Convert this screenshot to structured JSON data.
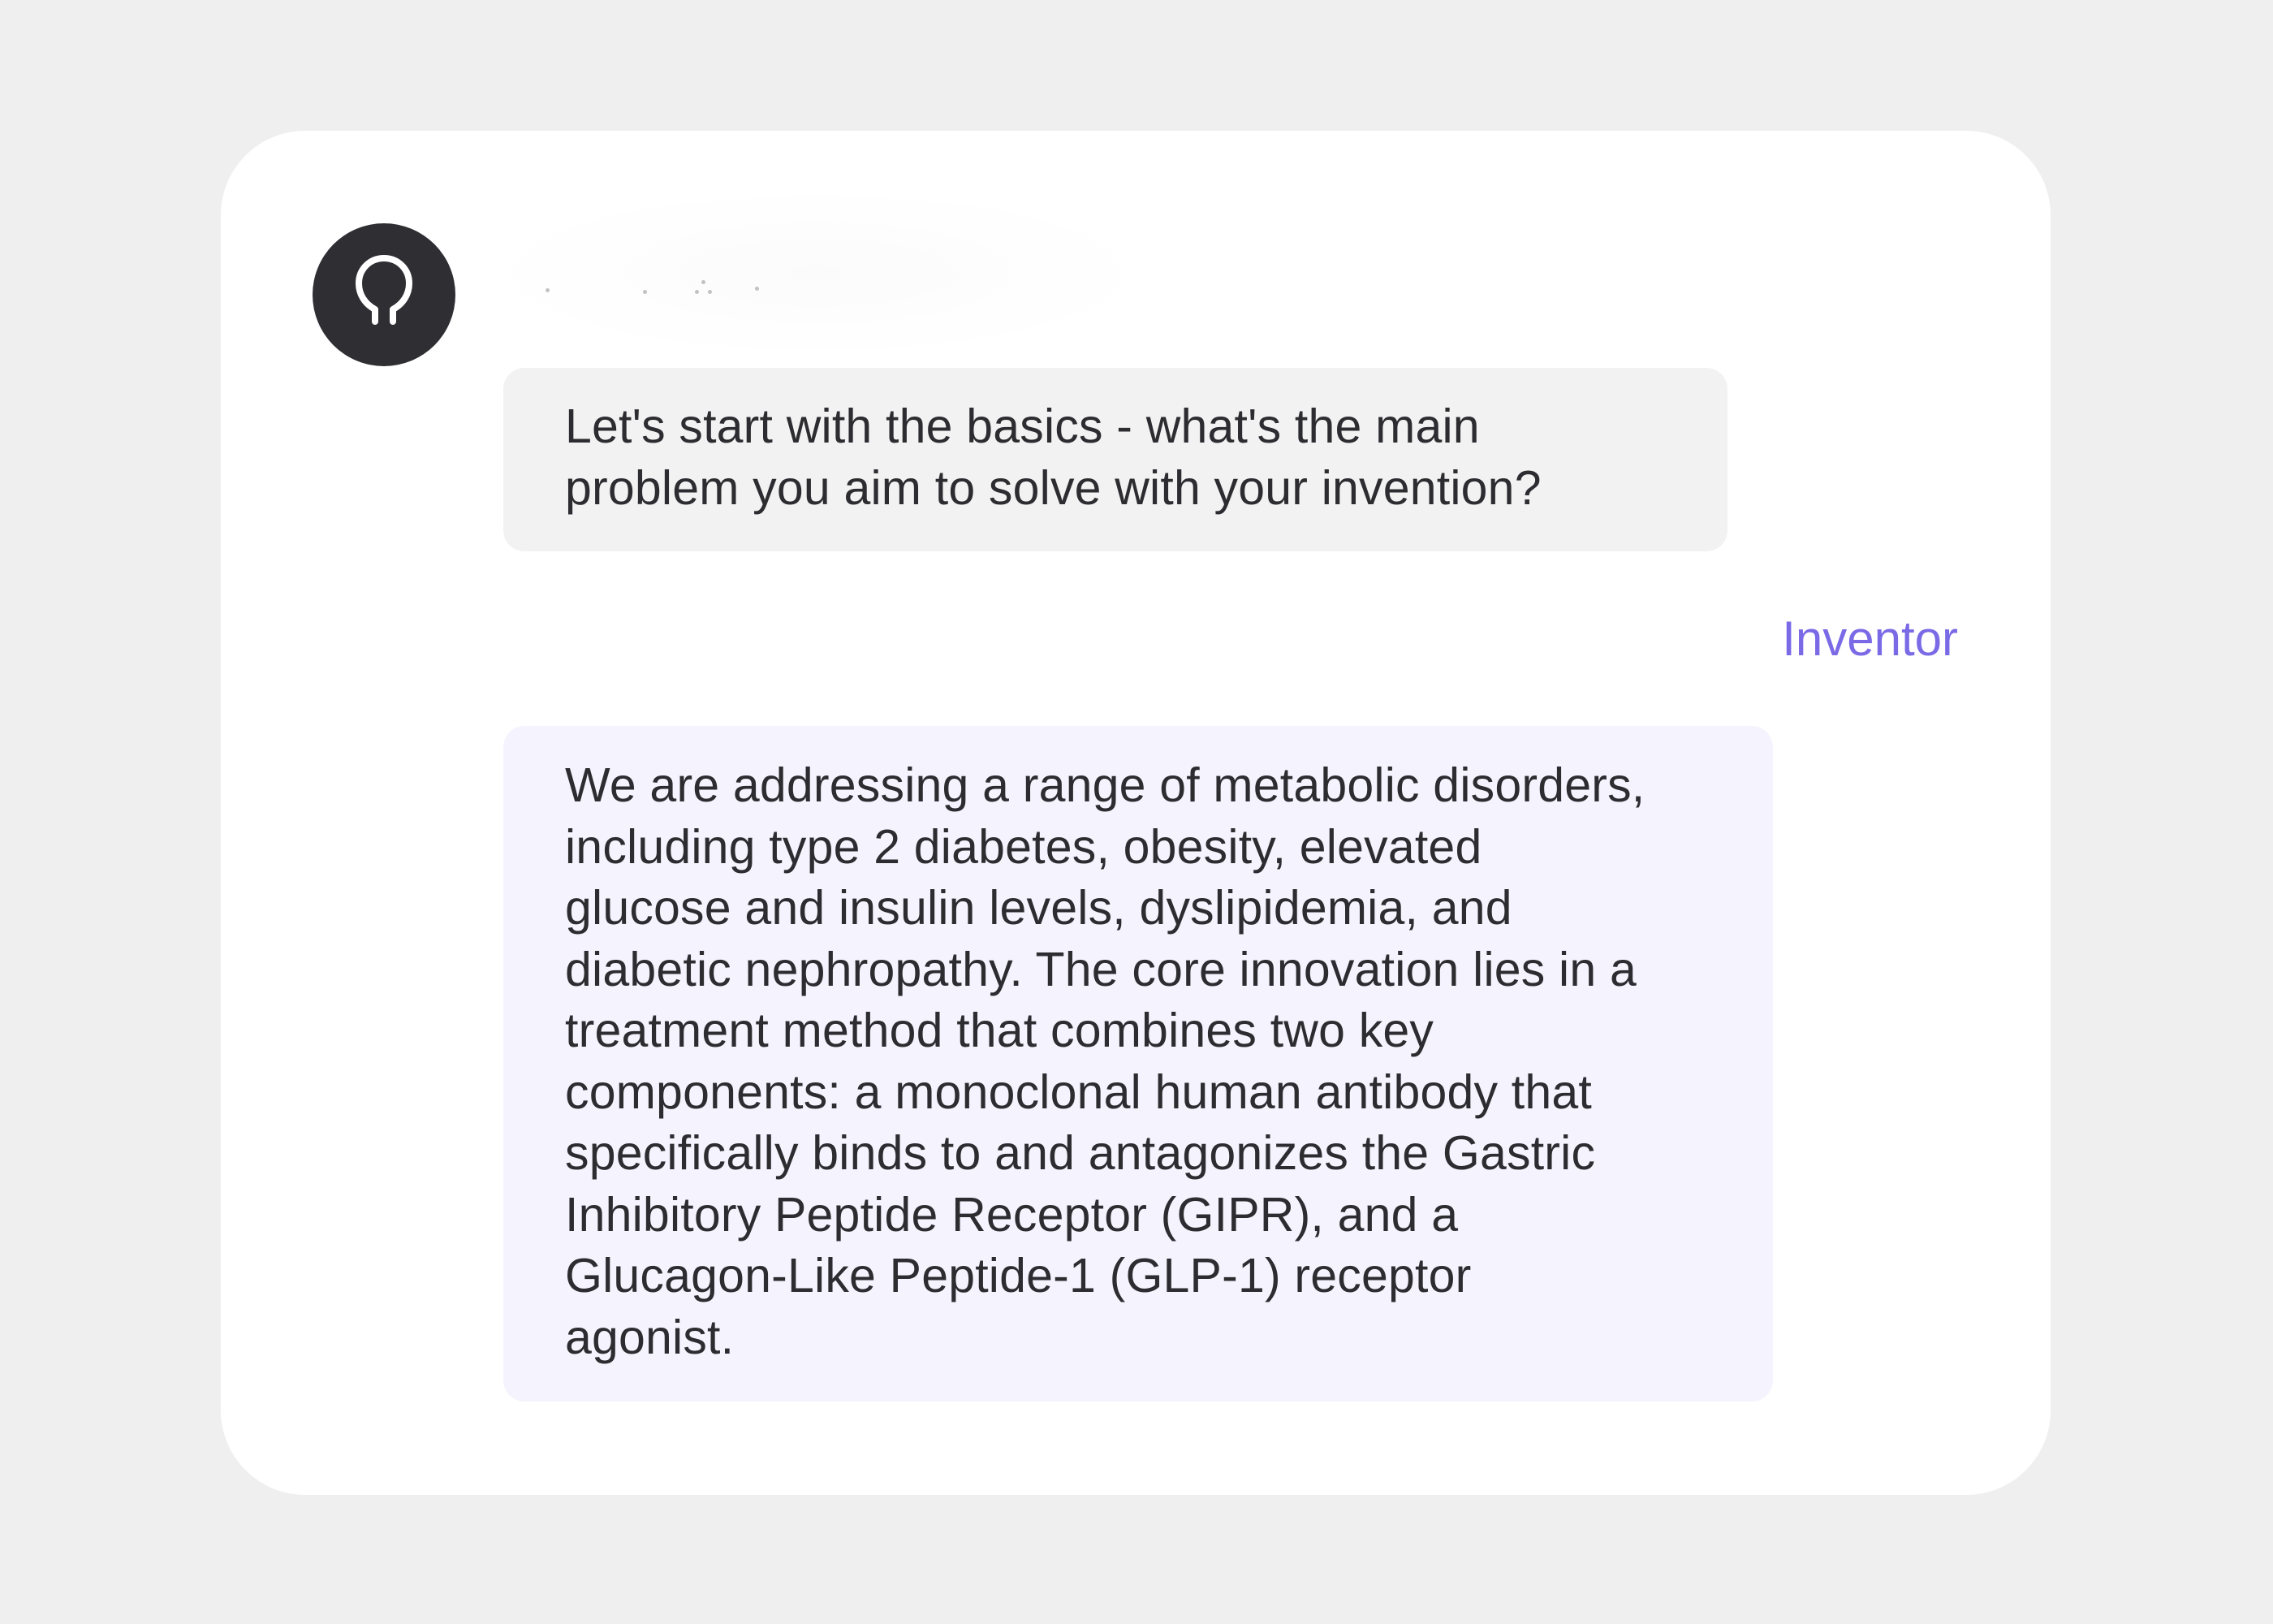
{
  "assistant": {
    "avatar_icon": "lightbulb-outline-icon",
    "typing_indicator": "typing-dots",
    "message": "Let's start with the basics - what's the main\nproblem you aim to solve with your invention?"
  },
  "user": {
    "sender_label": "Inventor",
    "message": "We are addressing a range of metabolic disorders,\nincluding type 2 diabetes, obesity, elevated\nglucose and insulin levels, dyslipidemia, and\ndiabetic nephropathy. The core innovation lies in a\ntreatment method that combines two key\ncomponents: a monoclonal human antibody that\nspecifically binds to and antagonizes the Gastric\nInhibitory Peptide Receptor (GIPR), and a\nGlucagon-Like Peptide-1 (GLP-1) receptor\nagonist."
  },
  "colors": {
    "background": "#efefef",
    "card": "#ffffff",
    "avatar": "#2e2e33",
    "assistant_bubble": "#f2f2f2",
    "user_bubble": "#f5f3fd",
    "sender_label": "#7a6ae6",
    "text": "#2d2d31"
  }
}
